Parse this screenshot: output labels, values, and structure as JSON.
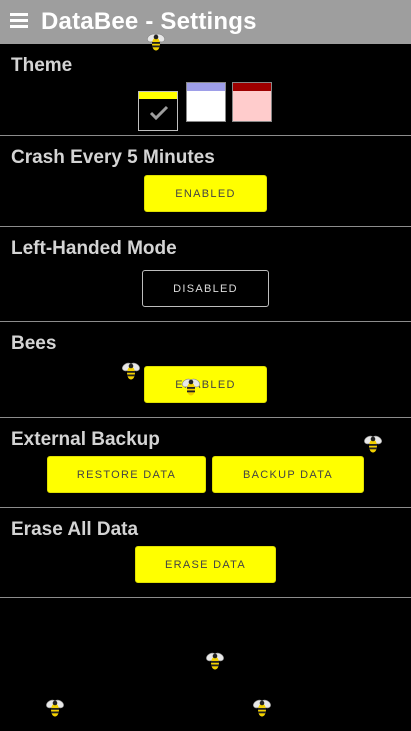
{
  "header": {
    "title": "DataBee - Settings",
    "menu_icon": "hamburger-menu-icon",
    "background": "#9e9e9e"
  },
  "theme": {
    "title": "Theme",
    "options": [
      {
        "name": "yellow",
        "accent": "#ffff00",
        "background": "#000000",
        "selected": true
      },
      {
        "name": "blue",
        "accent": "#9e9ee8",
        "background": "#ffffff",
        "selected": false
      },
      {
        "name": "red",
        "accent": "#9e0000",
        "background": "#ffcccc",
        "selected": false
      }
    ]
  },
  "crash": {
    "title": "Crash Every 5 Minutes",
    "button_label": "ENABLED"
  },
  "left_handed": {
    "title": "Left-Handed Mode",
    "button_label": "DISABLED"
  },
  "bees": {
    "title": "Bees",
    "button_label": "ENABLED",
    "icon": "bee-icon"
  },
  "external_backup": {
    "title": "External Backup",
    "restore_label": "RESTORE DATA",
    "backup_label": "BACKUP DATA"
  },
  "erase": {
    "title": "Erase All Data",
    "button_label": "ERASE DATA"
  },
  "colors": {
    "accent": "#ffff00",
    "page_background": "#000000",
    "divider": "#8c8c8c",
    "section_title": "#d4d4d4"
  }
}
